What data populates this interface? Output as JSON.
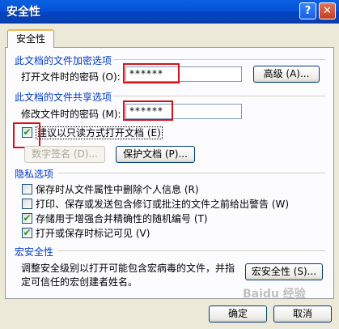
{
  "window": {
    "title": "安全性",
    "help": "?",
    "close": "✕"
  },
  "tab": "安全性",
  "encrypt": {
    "section": "此文档的文件加密选项",
    "open_label": "打开文件时的密码 (O):",
    "open_value": "******",
    "advanced_button": "高级 (A)..."
  },
  "share": {
    "section": "此文档的文件共享选项",
    "modify_label": "修改文件时的密码 (M):",
    "modify_value": "******",
    "readonly_label": "建议以只读方式打开文档 (E)",
    "readonly_checked": true,
    "signature_button": "数字签名 (D)...",
    "protect_button": "保护文档 (P)..."
  },
  "privacy": {
    "section": "隐私选项",
    "items": [
      {
        "label": "保存时从文件属性中删除个人信息 (R)",
        "checked": false
      },
      {
        "label": "打印、保存或发送包含修订或批注的文件之前给出警告 (W)",
        "checked": false
      },
      {
        "label": "存储用于增强合并精确性的随机编号 (T)",
        "checked": true
      },
      {
        "label": "打开或保存时标记可见 (V)",
        "checked": true
      }
    ]
  },
  "macro": {
    "section": "宏安全性",
    "description_line1": "调整安全级别以打开可能包含宏病毒的文件，并指",
    "description_line2": "定可信任的宏创建者姓名。",
    "button": "宏安全性 (S)..."
  },
  "footer": {
    "ok": "确定",
    "cancel": "取消"
  },
  "watermark": "Baidu 经验"
}
